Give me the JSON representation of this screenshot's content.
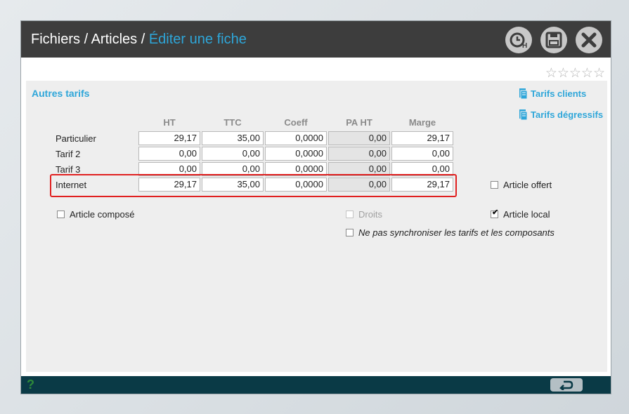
{
  "breadcrumb": {
    "part1": "Fichiers",
    "sep1": " / ",
    "part2": "Articles",
    "sep2": " / ",
    "current": "Éditer une fiche"
  },
  "title_icons": [
    "history-icon",
    "save-icon",
    "close-icon"
  ],
  "rating": {
    "stars": "☆☆☆☆☆",
    "value": 0,
    "max": 5
  },
  "section_title": "Autres tarifs",
  "links": {
    "clients": "Tarifs clients",
    "degressifs": "Tarifs dégressifs"
  },
  "columns": [
    "HT",
    "TTC",
    "Coeff",
    "PA HT",
    "Marge"
  ],
  "rows": [
    {
      "label": "Particulier",
      "values": [
        "29,17",
        "35,00",
        "0,0000",
        "0,00",
        "29,17"
      ]
    },
    {
      "label": "Tarif 2",
      "values": [
        "0,00",
        "0,00",
        "0,0000",
        "0,00",
        "0,00"
      ]
    },
    {
      "label": "Tarif 3",
      "values": [
        "0,00",
        "0,00",
        "0,0000",
        "0,00",
        "0,00"
      ]
    },
    {
      "label": "Internet",
      "values": [
        "29,17",
        "35,00",
        "0,0000",
        "0,00",
        "29,17"
      ]
    }
  ],
  "checkboxes": {
    "article_offert": {
      "label": "Article offert",
      "checked": false
    },
    "article_compose": {
      "label": "Article composé",
      "checked": false
    },
    "droits": {
      "label": "Droits",
      "checked": false,
      "disabled": true
    },
    "article_local": {
      "label": "Article local",
      "checked": true
    },
    "no_sync": {
      "label": "Ne pas synchroniser les tarifs et les composants",
      "checked": false
    }
  },
  "footer": {
    "help": "?"
  },
  "colors": {
    "accent": "#2ea6d9",
    "titlebar": "#3d3d3d",
    "footer": "#0a3a46",
    "highlight": "#e02020"
  }
}
